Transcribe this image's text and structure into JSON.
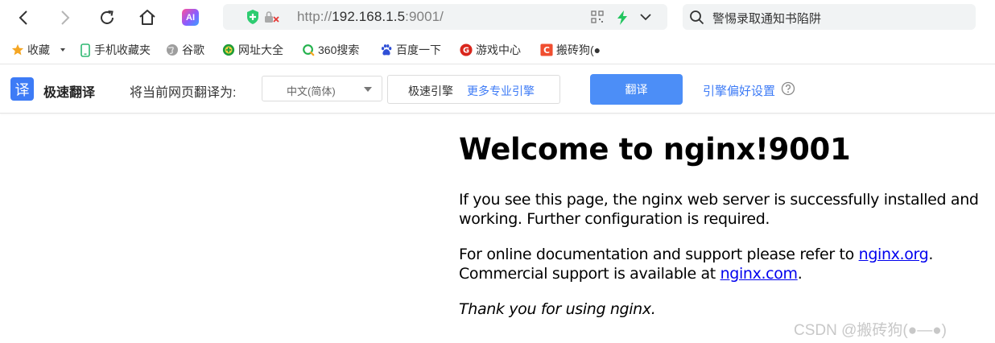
{
  "browser": {
    "address": {
      "scheme": "http://",
      "host": "192.168.1.5",
      "port_path": ":9001/"
    },
    "search": {
      "text": "警惕录取通知书陷阱"
    },
    "ai_label": "AI"
  },
  "bookmarks": [
    {
      "label": "收藏"
    },
    {
      "label": "手机收藏夹"
    },
    {
      "label": "谷歌"
    },
    {
      "label": "网址大全"
    },
    {
      "label": "360搜索"
    },
    {
      "label": "百度一下"
    },
    {
      "label": "游戏中心"
    },
    {
      "label": "搬砖狗(●"
    }
  ],
  "translate": {
    "logo_char": "译",
    "name": "极速翻译",
    "prompt": "将当前网页翻译为:",
    "language": "中文(简体)",
    "engine": "极速引擎",
    "more_engines": "更多专业引擎",
    "button": "翻译",
    "preferences": "引擎偏好设置"
  },
  "page": {
    "title": "Welcome to nginx!9001",
    "p1_line1": "If you see this page, the nginx web server is successfully installed and",
    "p1_line2": "working. Further configuration is required.",
    "p2_line1_prefix": "For online documentation and support please refer to ",
    "p2_link1": "nginx.org",
    "p2_line1_suffix": ".",
    "p2_line2_prefix": "Commercial support is available at ",
    "p2_link2": "nginx.com",
    "p2_line2_suffix": ".",
    "p3": "Thank you for using nginx."
  },
  "watermark": "CSDN @搬砖狗(●—●)",
  "colors": {
    "accent": "#4c8ef7",
    "link": "#0000ee",
    "security_green": "#2ecc71"
  }
}
